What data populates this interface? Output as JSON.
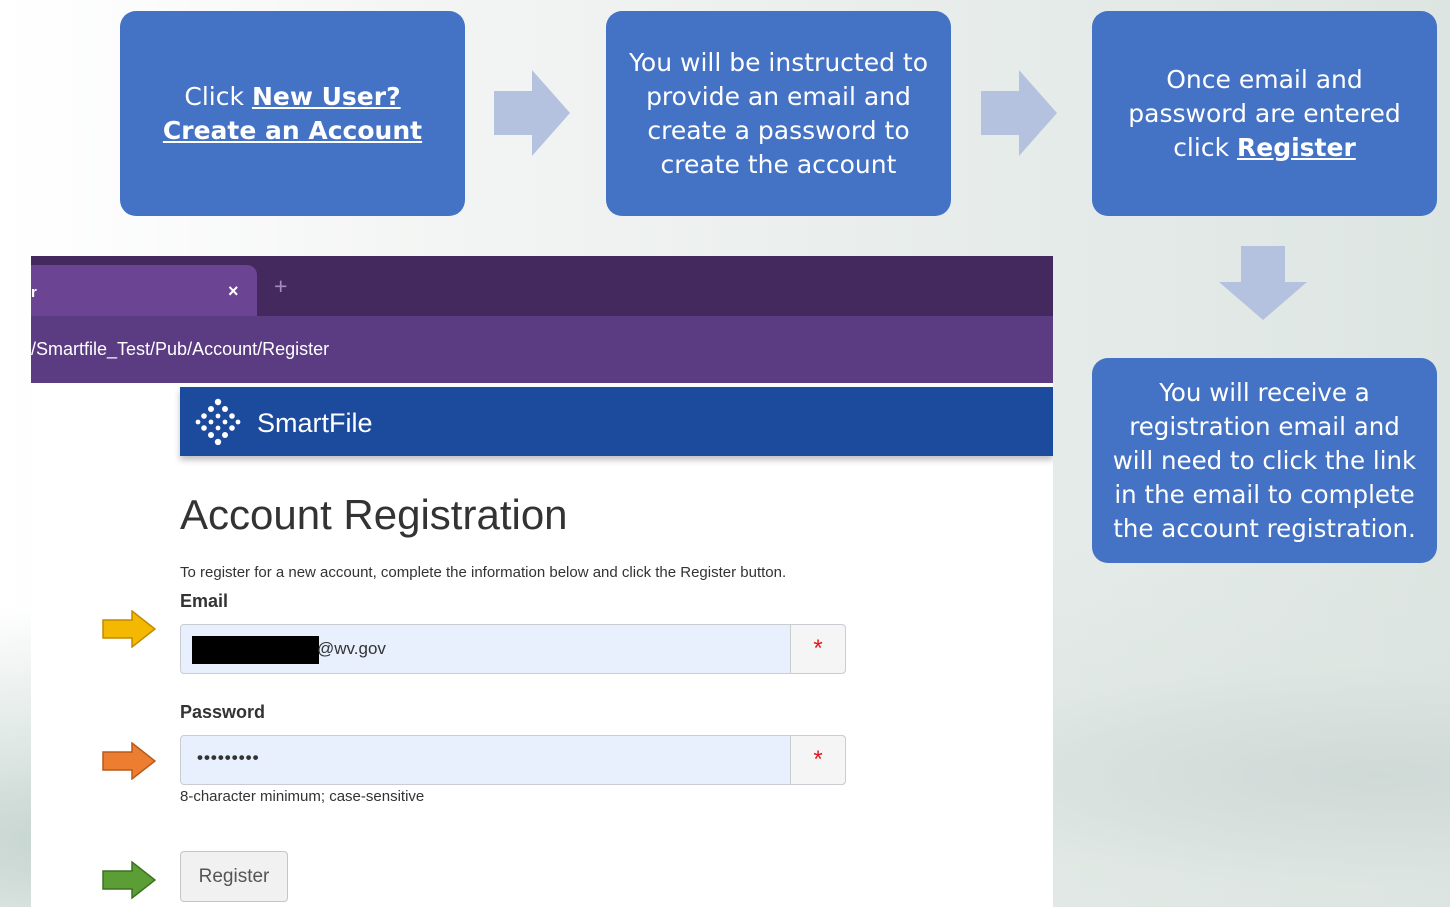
{
  "steps": {
    "step1": {
      "text_before": "Click ",
      "link": "New User? Create an Account"
    },
    "step2": {
      "text": "You will be instructed to provide  an email and create a password to create the account"
    },
    "step3": {
      "text_before": "Once email and password are entered click ",
      "link": "Register"
    },
    "step4": {
      "text": "You will receive a registration email and will need to click the link in the email to complete the account registration."
    }
  },
  "browser": {
    "tab_title": "r",
    "tab_close": "×",
    "new_tab": "+",
    "url": "/Smartfile_Test/Pub/Account/Register"
  },
  "app": {
    "name": "SmartFile",
    "page_title": "Account Registration",
    "description": "To register for a new account, complete the information below and click the Register button.",
    "email_label": "Email",
    "email_value": "@wv.gov",
    "password_label": "Password",
    "password_value": "•••••••••",
    "required_marker": "*",
    "password_hint": "8-character minimum; case-sensitive",
    "register_label": "Register"
  },
  "colors": {
    "step_box": "#4472c4",
    "flow_arrow": "#b4c2e0",
    "email_arrow": "#f5b800",
    "password_arrow": "#ed7d31",
    "register_arrow": "#5a9e35",
    "app_bar": "#1c4a9c"
  },
  "icons": {
    "logo": "smartfile-logo-icon",
    "close": "close-icon",
    "required": "required-asterisk-icon"
  }
}
